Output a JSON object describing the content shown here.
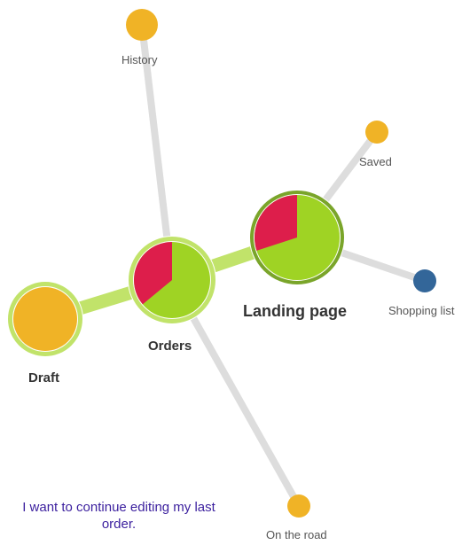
{
  "colors": {
    "edge_gray": "#dddddd",
    "edge_green": "#c1e36a",
    "ring_light": "#c1e36a",
    "ring_dark": "#7aa52a",
    "pie_green": "#9fd324",
    "pie_red": "#dd1e4b",
    "node_orange": "#f0b326",
    "node_blue": "#336699",
    "caption": "#3b1f9e"
  },
  "nodes": [
    {
      "id": "history",
      "label": "History",
      "color": "orange"
    },
    {
      "id": "saved",
      "label": "Saved",
      "color": "orange"
    },
    {
      "id": "landing",
      "label": "Landing page",
      "pie_red_fraction": 0.3
    },
    {
      "id": "shopping",
      "label": "Shopping list",
      "color": "blue"
    },
    {
      "id": "orders",
      "label": "Orders",
      "pie_red_fraction": 0.36
    },
    {
      "id": "draft",
      "label": "Draft",
      "color": "orange"
    },
    {
      "id": "road",
      "label": "On the road",
      "color": "orange"
    }
  ],
  "edges": [
    {
      "from": "draft",
      "to": "orders",
      "style": "green"
    },
    {
      "from": "orders",
      "to": "landing",
      "style": "green"
    },
    {
      "from": "history",
      "to": "orders",
      "style": "gray"
    },
    {
      "from": "orders",
      "to": "road",
      "style": "gray"
    },
    {
      "from": "landing",
      "to": "saved",
      "style": "gray"
    },
    {
      "from": "landing",
      "to": "shopping",
      "style": "gray"
    }
  ],
  "caption": "I want to continue editing my last order."
}
